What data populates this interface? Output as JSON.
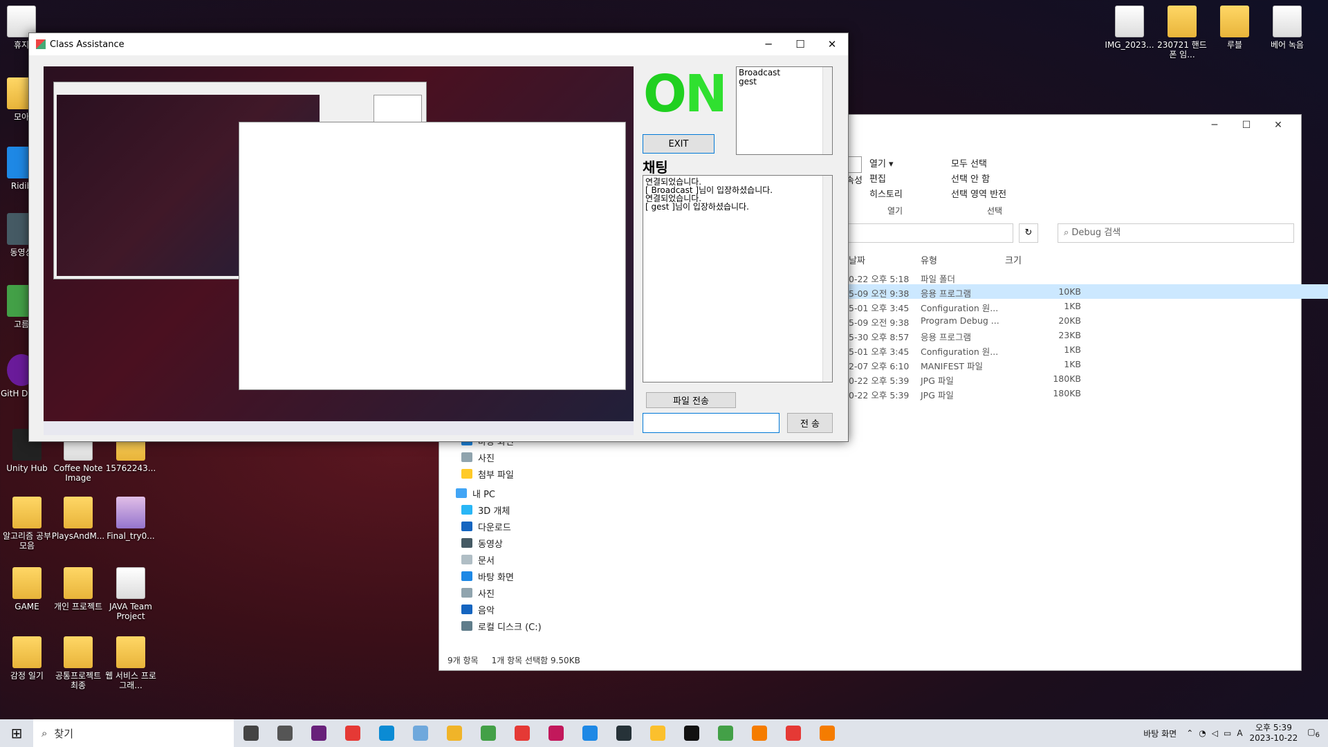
{
  "desktop": {
    "icons": [
      {
        "label": "휴지",
        "x": "left"
      },
      {
        "label": "모아",
        "x": "left"
      },
      {
        "label": "Ridib",
        "x": "left"
      },
      {
        "label": "동영상",
        "x": "left"
      },
      {
        "label": "고름",
        "x": "left"
      },
      {
        "label": "GitH Desk",
        "x": "left"
      },
      {
        "label": "Unity Hub"
      },
      {
        "label": "Coffee Note Image"
      },
      {
        "label": "15762243..."
      },
      {
        "label": "알고리즘 공부 모음"
      },
      {
        "label": "PlaysAndM..."
      },
      {
        "label": "Final_try0..."
      },
      {
        "label": "GAME"
      },
      {
        "label": "개인 프로젝트"
      },
      {
        "label": "JAVA Team Project"
      },
      {
        "label": "감정 일기"
      },
      {
        "label": "공통프로젝트 최종"
      },
      {
        "label": "웹 서비스 프로그래..."
      },
      {
        "label": "IMG_2023..."
      },
      {
        "label": "230721 핸드폰 임..."
      },
      {
        "label": "루블"
      },
      {
        "label": "베어 녹음"
      }
    ]
  },
  "explorer": {
    "ribbon": {
      "open_label": "열기",
      "edit_label": "편집",
      "history_label": "히스토리",
      "properties_label": "속성",
      "open_group_label": "열기",
      "select_all_label": "모두 선택",
      "select_none_label": "선택 안 함",
      "invert_selection_label": "선택 영역 반전",
      "select_group_label": "선택"
    },
    "search_placeholder": "Debug 검색",
    "columns": {
      "date": "날짜",
      "type": "유형",
      "size": "크기"
    },
    "rows": [
      {
        "date": "0-22 오후 5:18",
        "type": "파일 폴더",
        "size": "",
        "selected": false
      },
      {
        "date": "5-09 오전 9:38",
        "type": "응용 프로그램",
        "size": "10KB",
        "selected": true
      },
      {
        "date": "5-01 오후 3:45",
        "type": "Configuration 원...",
        "size": "1KB",
        "selected": false
      },
      {
        "date": "5-09 오전 9:38",
        "type": "Program Debug ...",
        "size": "20KB",
        "selected": false
      },
      {
        "date": "5-30 오후 8:57",
        "type": "응용 프로그램",
        "size": "23KB",
        "selected": false
      },
      {
        "date": "5-01 오후 3:45",
        "type": "Configuration 원...",
        "size": "1KB",
        "selected": false
      },
      {
        "date": "2-07 오후 6:10",
        "type": "MANIFEST 파일",
        "size": "1KB",
        "selected": false
      },
      {
        "date": "0-22 오후 5:39",
        "type": "JPG 파일",
        "size": "180KB",
        "selected": false
      },
      {
        "date": "0-22 오후 5:39",
        "type": "JPG 파일",
        "size": "180KB",
        "selected": false
      }
    ],
    "nav": [
      {
        "label": "바탕 화면",
        "color": "#1e88e5"
      },
      {
        "label": "사진",
        "color": "#90a4ae"
      },
      {
        "label": "첨부 파일",
        "color": "#ffca28"
      },
      {
        "label": "내 PC",
        "color": "#42a5f5"
      },
      {
        "label": "3D 개체",
        "color": "#29b6f6"
      },
      {
        "label": "다운로드",
        "color": "#1565c0"
      },
      {
        "label": "동영상",
        "color": "#455a64"
      },
      {
        "label": "문서",
        "color": "#b0bec5"
      },
      {
        "label": "바탕 화면",
        "color": "#1e88e5"
      },
      {
        "label": "사진",
        "color": "#90a4ae"
      },
      {
        "label": "음악",
        "color": "#1565c0"
      },
      {
        "label": "로컬 디스크 (C:)",
        "color": "#607d8b"
      }
    ],
    "status_count": "9개 항목",
    "status_selected": "1개 항목 선택함 9.50KB"
  },
  "app": {
    "title": "Class Assistance",
    "minimize_glyph": "─",
    "maximize_glyph": "☐",
    "close_glyph": "✕",
    "logo_o": "O",
    "logo_n": "N",
    "users": [
      "Broadcast",
      "gest"
    ],
    "exit_label": "EXIT",
    "chat_heading": "채팅",
    "chat_lines": [
      "연결되었습니다.",
      "[ Broadcast ]님이 입장하셨습니다.",
      "연결되었습니다.",
      "[ gest ]님이 입장하셨습니다."
    ],
    "file_send_label": "파일 전송",
    "message_value": "",
    "send_label": "전 송"
  },
  "taskbar": {
    "search_label": "찾기",
    "desktop_label": "바탕 화면",
    "ime_label": "A",
    "time": "오후 5:39",
    "date": "2023-10-22",
    "notification_count": "6",
    "apps": [
      {
        "name": "task-view-icon",
        "color": "#444"
      },
      {
        "name": "settings-icon",
        "color": "#555"
      },
      {
        "name": "visual-studio-icon",
        "color": "#68217a"
      },
      {
        "name": "chrome-icon",
        "color": "#e53935"
      },
      {
        "name": "edge-icon",
        "color": "#0b8bd4"
      },
      {
        "name": "app-icon",
        "color": "#6fa8dc"
      },
      {
        "name": "file-explorer-icon",
        "color": "#f0b429"
      },
      {
        "name": "chrome-profile-icon",
        "color": "#43a047"
      },
      {
        "name": "opera-icon",
        "color": "#e53935"
      },
      {
        "name": "jetbrains-icon",
        "color": "#c2185b"
      },
      {
        "name": "vscode-icon",
        "color": "#1e88e5"
      },
      {
        "name": "app-round-icon",
        "color": "#263238"
      },
      {
        "name": "kakaotalk-icon",
        "color": "#fbc02d"
      },
      {
        "name": "notion-icon",
        "color": "#111"
      },
      {
        "name": "chrome-alt-icon",
        "color": "#43a047"
      },
      {
        "name": "winforms-app-icon",
        "color": "#f57c00"
      },
      {
        "name": "winforms-app-icon-2",
        "color": "#e53935"
      },
      {
        "name": "winforms-app-icon-3",
        "color": "#f57c00"
      }
    ]
  }
}
